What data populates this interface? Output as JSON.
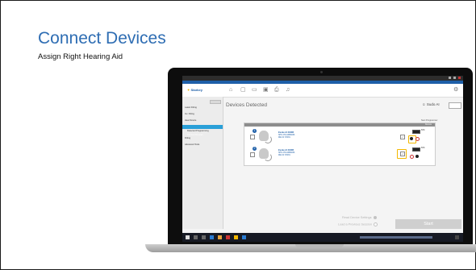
{
  "slide": {
    "title": "Connect Devices",
    "subtitle": "Assign Right Hearing Aid"
  },
  "app": {
    "brand": "Starkey",
    "sidebar": [
      "Latest Fitting",
      "Inv. Fitting",
      "Hear Device",
      "Connect Devices",
      "Detected Programming",
      "Fitting",
      "Advanced Tools"
    ],
    "main_title": "Devices Detected",
    "user_label": "Sudo AI",
    "next_programmer": "Next Programmer",
    "panel_header": "1 Device Detected",
    "panel_header_right": "Remote",
    "devices": [
      {
        "number": "1",
        "name": "Evoke AI 2400R",
        "serial": "SHN 4744-8868236",
        "detail": "RIE 64.7150%",
        "battery": "60%"
      },
      {
        "number": "2",
        "name": "Evoke AI 2400R",
        "serial": "SHN 4744-8868236",
        "detail": "RIE 64.7150%",
        "battery": "60%"
      }
    ],
    "footer": {
      "read_settings": "Read Device Settings",
      "load_session": "Load a Previous Session",
      "start": "Start"
    }
  },
  "colors": {
    "title_blue": "#2e6db3",
    "highlight": "#f3b800",
    "app_blue": "#1e5fa8",
    "sidebar_selected": "#2aa0d8"
  }
}
